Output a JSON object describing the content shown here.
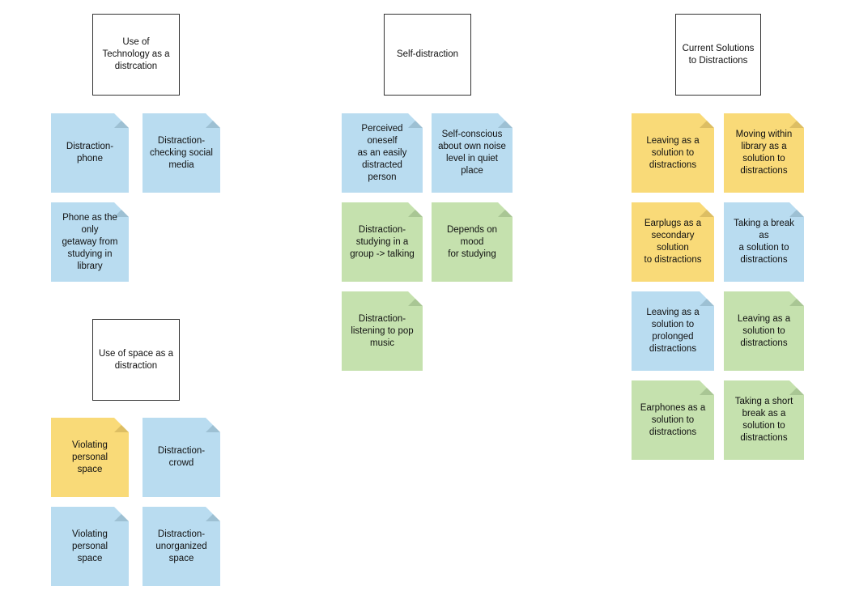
{
  "board": {
    "background": "#ffffff",
    "colors": {
      "note_blue": "#b9dcf0",
      "note_green": "#c5e1ae",
      "note_yellow": "#f9da78",
      "header_border": "#333333",
      "header_fill": "#ffffff",
      "text": "#111111"
    }
  },
  "groups": [
    {
      "id": "technology",
      "header": "Use of\nTechnology as a\ndistrcation",
      "notes": [
        {
          "text": "Distraction- phone",
          "color": "blue"
        },
        {
          "text": "Distraction-\nchecking social\nmedia",
          "color": "blue"
        },
        {
          "text": "Phone as the only\ngetaway from\nstudying in library",
          "color": "blue"
        }
      ]
    },
    {
      "id": "space",
      "header": "Use of space as a\ndistraction",
      "notes": [
        {
          "text": "Violating personal\nspace",
          "color": "yellow"
        },
        {
          "text": "Distraction- crowd",
          "color": "blue"
        },
        {
          "text": "Violating personal\nspace",
          "color": "blue"
        },
        {
          "text": "Distraction-\nunorganized\nspace",
          "color": "blue"
        }
      ]
    },
    {
      "id": "self-distraction",
      "header": "Self-distraction",
      "notes": [
        {
          "text": "Perceived oneself\nas an easily\ndistracted person",
          "color": "blue"
        },
        {
          "text": "Self-conscious\nabout own noise\nlevel in quiet place",
          "color": "blue"
        },
        {
          "text": "Distraction-\nstudying in a\ngroup -> talking",
          "color": "green"
        },
        {
          "text": "Depends on mood\nfor studying",
          "color": "green"
        },
        {
          "text": "Distraction-\nlistening to pop\nmusic",
          "color": "green"
        }
      ]
    },
    {
      "id": "current-solutions",
      "header": "Current Solutions\nto Distractions",
      "notes": [
        {
          "text": "Leaving as a\nsolution to\ndistractions",
          "color": "yellow"
        },
        {
          "text": "Moving within\nlibrary as a\nsolution to\ndistractions",
          "color": "yellow"
        },
        {
          "text": "Earplugs as a\nsecondary solution\nto distractions",
          "color": "yellow"
        },
        {
          "text": "Taking a break as\na solution to\ndistractions",
          "color": "blue"
        },
        {
          "text": "Leaving as a\nsolution to\nprolonged\ndistractions",
          "color": "blue"
        },
        {
          "text": "Leaving as a\nsolution to\ndistractions",
          "color": "green"
        },
        {
          "text": "Earphones as a\nsolution to\ndistractions",
          "color": "green"
        },
        {
          "text": "Taking a short\nbreak as a\nsolution to\ndistractions",
          "color": "green"
        }
      ]
    }
  ]
}
